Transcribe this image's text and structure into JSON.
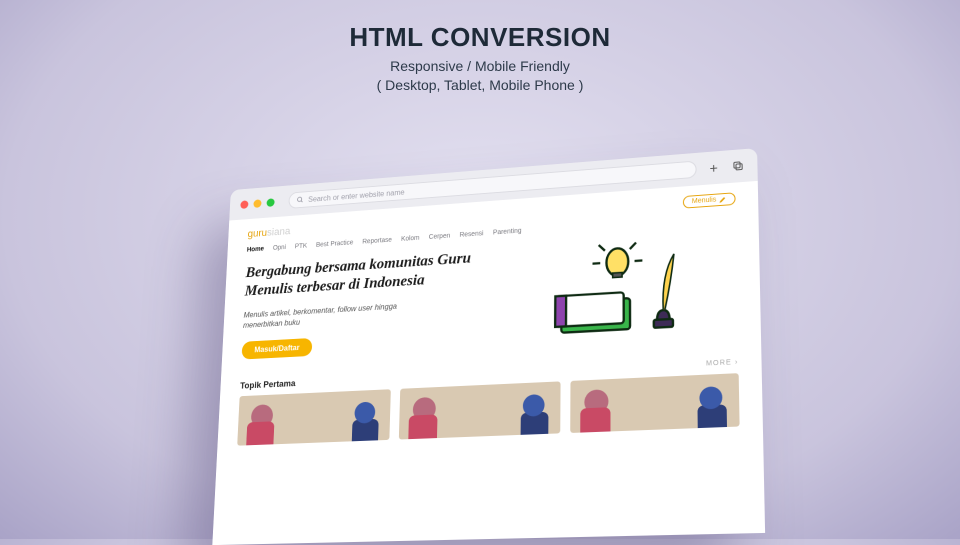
{
  "promo": {
    "title": "HTML CONVERSION",
    "line1": "Responsive / Mobile Friendly",
    "line2": "( Desktop, Tablet, Mobile Phone )"
  },
  "browser": {
    "address_placeholder": "Search or enter website name"
  },
  "site": {
    "logo_main": "guru",
    "logo_sub": "siana",
    "cta_pill": "Menulis",
    "nav": [
      "Home",
      "Opni",
      "PTK",
      "Best Practice",
      "Reportase",
      "Kolom",
      "Cerpen",
      "Resensi",
      "Parenting"
    ],
    "hero_title": "Bergabung bersama komunitas Guru Menulis terbesar di Indonesia",
    "hero_sub": "Menulis artikel, berkomentar, follow user hingga menerbitkan buku",
    "hero_cta": "Masuk/Daftar",
    "section_title": "Topik Pertama",
    "more": "MORE"
  }
}
